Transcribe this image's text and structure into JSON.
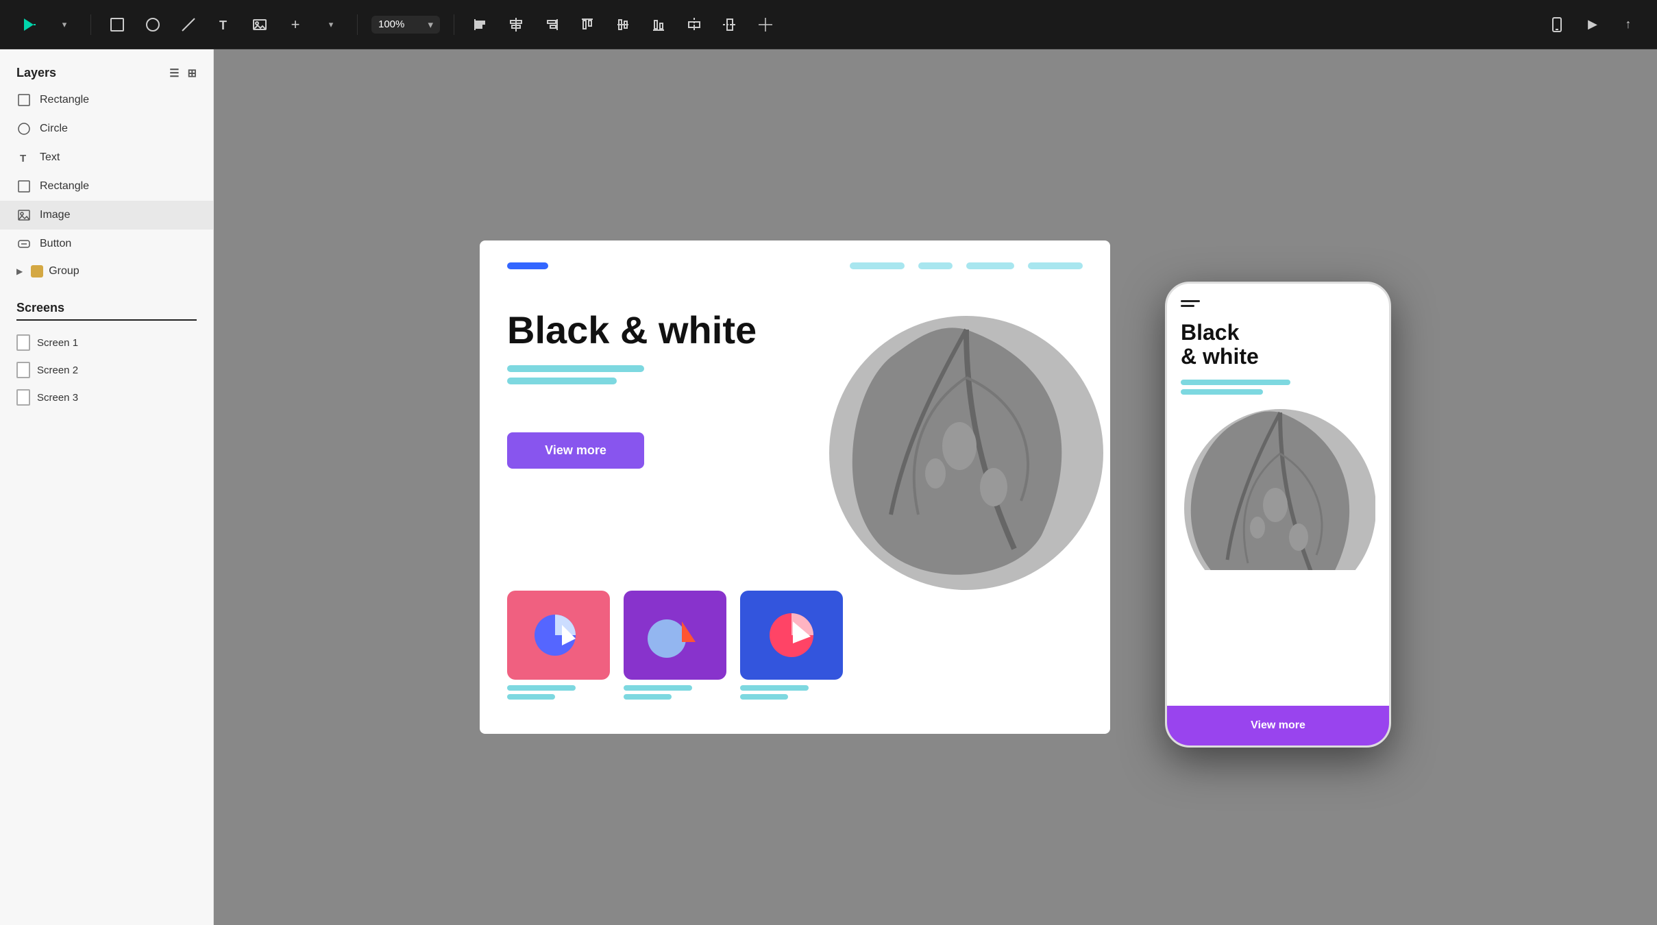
{
  "toolbar": {
    "zoom": "100%",
    "zoom_dropdown": "▾",
    "play_button": "▶",
    "upload_icon": "↑",
    "mobile_icon": "📱"
  },
  "sidebar": {
    "title": "Layers",
    "layers": [
      {
        "id": "rectangle1",
        "label": "Rectangle",
        "icon": "rectangle"
      },
      {
        "id": "circle1",
        "label": "Circle",
        "icon": "circle"
      },
      {
        "id": "text1",
        "label": "Text",
        "icon": "text"
      },
      {
        "id": "rectangle2",
        "label": "Rectangle",
        "icon": "rectangle"
      },
      {
        "id": "image1",
        "label": "Image",
        "icon": "image",
        "selected": true
      },
      {
        "id": "button1",
        "label": "Button",
        "icon": "button"
      },
      {
        "id": "group1",
        "label": "Group",
        "icon": "group"
      }
    ],
    "screens_title": "Screens",
    "screens": [
      {
        "id": "screen1",
        "label": "Screen 1"
      },
      {
        "id": "screen2",
        "label": "Screen 2"
      },
      {
        "id": "screen3",
        "label": "Screen 3"
      }
    ]
  },
  "canvas": {
    "nav_logo_color": "#3366ff",
    "hero_title": "Black & white",
    "button_label": "View more",
    "button_color": "#8855ee",
    "cards": [
      {
        "id": "card1",
        "bg": "#f06080"
      },
      {
        "id": "card2",
        "bg": "#8833cc"
      },
      {
        "id": "card3",
        "bg": "#3355dd"
      }
    ]
  },
  "mobile": {
    "title": "Black\n& white",
    "button_label": "View more",
    "button_color": "#9944ee"
  }
}
